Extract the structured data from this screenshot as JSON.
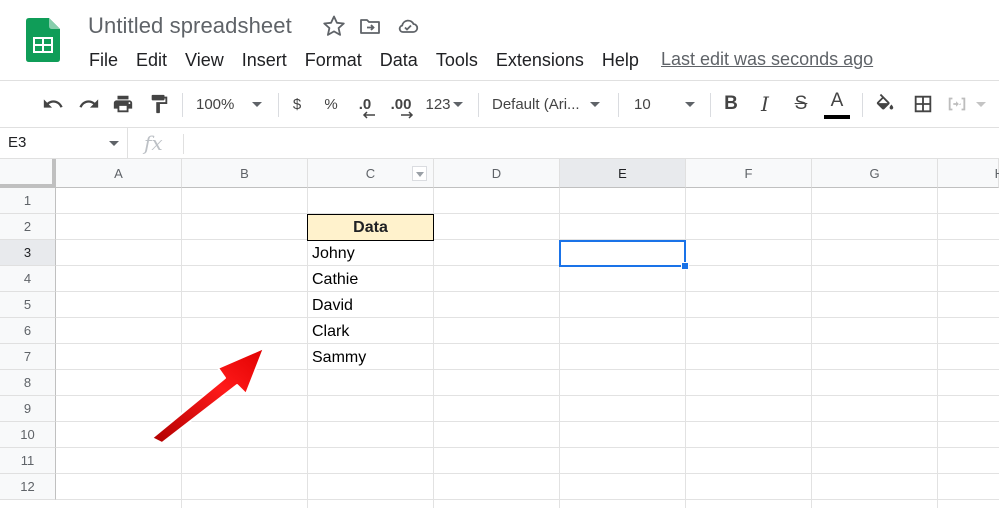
{
  "header": {
    "title": "Untitled spreadsheet",
    "menu": [
      "File",
      "Edit",
      "View",
      "Insert",
      "Format",
      "Data",
      "Tools",
      "Extensions",
      "Help"
    ],
    "last_edit": "Last edit was seconds ago"
  },
  "toolbar": {
    "zoom": "100%",
    "currency": "$",
    "percent": "%",
    "decrease_decimal": ".0",
    "increase_decimal": ".00",
    "more_formats": "123",
    "font": "Default (Ari...",
    "font_size": "10",
    "bold": "B",
    "italic": "I",
    "strike": "S",
    "text_color": "A"
  },
  "formula_bar": {
    "name_box": "E3",
    "fx_label": "fx"
  },
  "columns": [
    "A",
    "B",
    "C",
    "D",
    "E",
    "F",
    "G",
    "H"
  ],
  "rows": [
    "1",
    "2",
    "3",
    "4",
    "5",
    "6",
    "7",
    "8",
    "9",
    "10",
    "11",
    "12"
  ],
  "cells": {
    "C2": "Data",
    "C3": "Johny",
    "C4": "Cathie",
    "C5": "David",
    "C6": "Clark",
    "C7": "Sammy"
  },
  "colors": {
    "accent": "#1a73e8",
    "header_fill": "#fff2cc",
    "logo_green": "#0f9d58",
    "arrow_red": "#e00000"
  }
}
